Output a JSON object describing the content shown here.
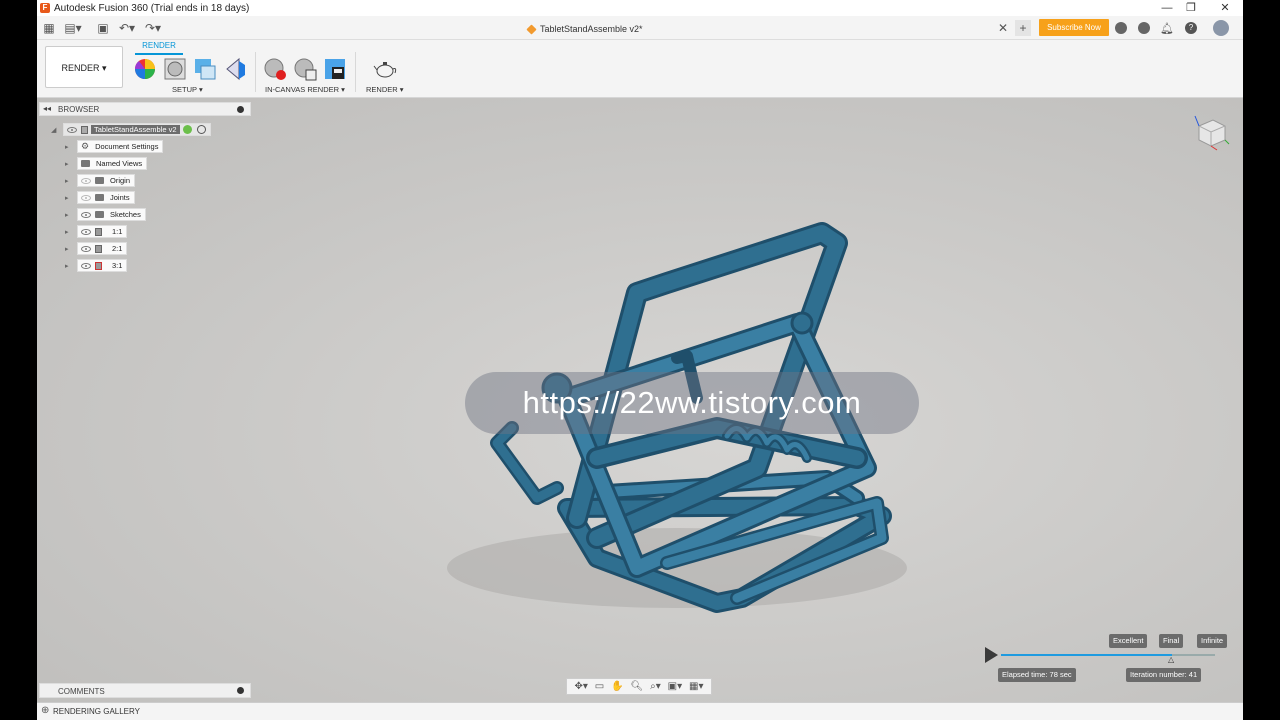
{
  "window": {
    "title": "Autodesk Fusion 360 (Trial ends in 18 days)",
    "app_icon": "F"
  },
  "document": {
    "tab_title": "TabletStandAssemble v2*"
  },
  "header": {
    "subscribe_label": "Subscribe Now",
    "accent": "#f7a11a"
  },
  "ribbon": {
    "workspace_label": "RENDER ▾",
    "active_tab": "RENDER",
    "groups": [
      {
        "label": "SETUP ▾"
      },
      {
        "label": "IN-CANVAS RENDER ▾"
      },
      {
        "label": "RENDER ▾"
      }
    ]
  },
  "browser": {
    "header": "BROWSER",
    "root": "TabletStandAssemble v2",
    "items": [
      {
        "label": "Document Settings",
        "icon": "gear-icon"
      },
      {
        "label": "Named Views",
        "icon": "folder-icon"
      },
      {
        "label": "Origin",
        "icon": "folder-icon"
      },
      {
        "label": "Joints",
        "icon": "folder-icon"
      },
      {
        "label": "Sketches",
        "icon": "folder-icon"
      },
      {
        "label": "1:1",
        "icon": "component-icon"
      },
      {
        "label": "2:1",
        "icon": "component-icon"
      },
      {
        "label": "3:1",
        "icon": "component-icon"
      }
    ]
  },
  "viewport": {
    "watermark": "https://22ww.tistory.com",
    "model_color": "#2f6f90"
  },
  "render_progress": {
    "quality_levels": [
      "Excellent",
      "Final",
      "Infinite"
    ],
    "elapsed": "Elapsed time: 78 sec",
    "iteration": "Iteration number: 41",
    "progress_fraction": 0.8
  },
  "comments": {
    "header": "COMMENTS"
  },
  "gallery": {
    "header": "RENDERING GALLERY"
  }
}
